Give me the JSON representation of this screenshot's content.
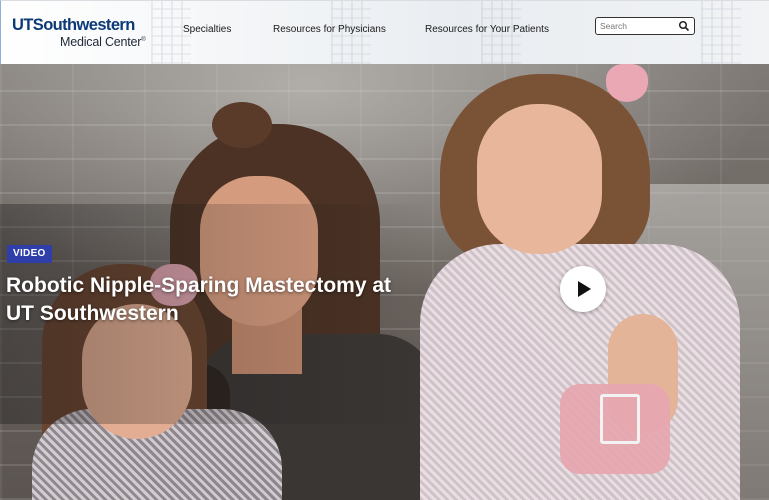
{
  "header": {
    "logo_primary": "UTSouthwestern",
    "logo_secondary": "Medical Center",
    "logo_mark": "®",
    "nav": [
      {
        "label": "Specialties"
      },
      {
        "label": "Resources for Physicians"
      },
      {
        "label": "Resources for Your Patients"
      }
    ],
    "search": {
      "placeholder": "Search",
      "icon": "search-icon"
    }
  },
  "hero": {
    "badge": "VIDEO",
    "title": "Robotic Nipple-Sparing Mastectomy at UT Southwestern",
    "play_icon": "play-icon",
    "colors": {
      "badge_bg": "#2f3ea8",
      "title_text": "#ffffff",
      "brand_blue": "#0b3a77"
    }
  }
}
